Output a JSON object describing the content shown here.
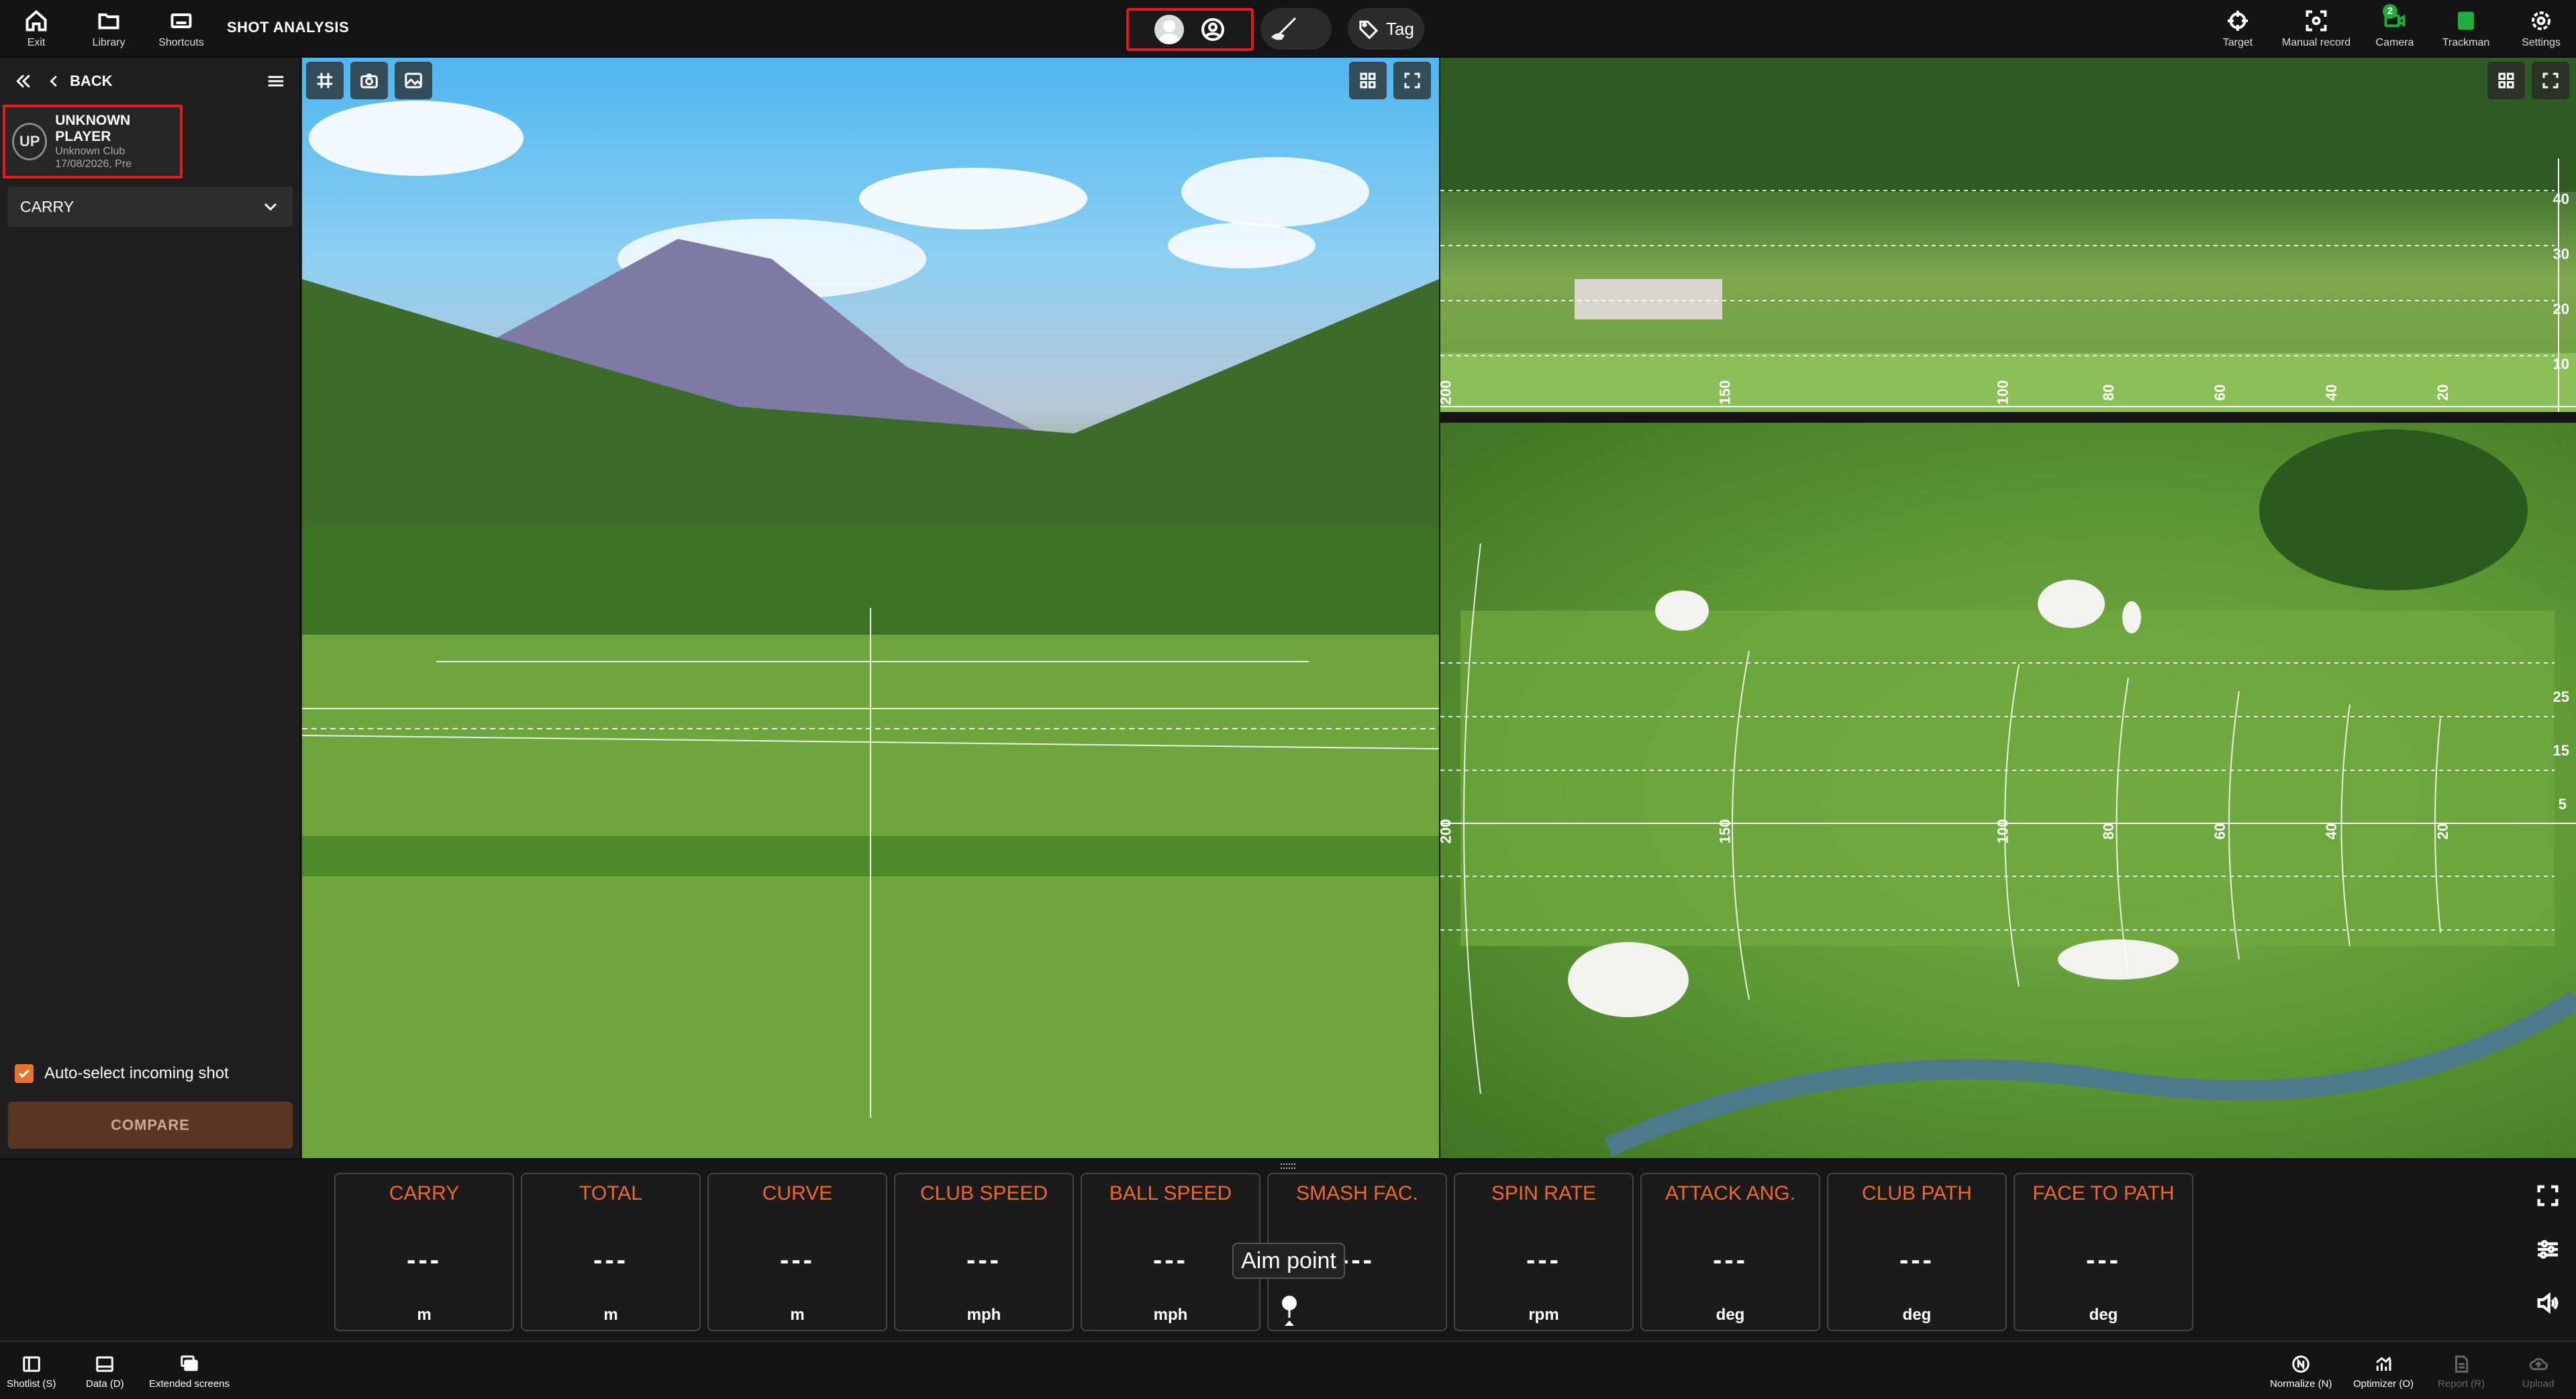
{
  "topbar": {
    "exit_label": "Exit",
    "library_label": "Library",
    "shortcuts_label": "Shortcuts",
    "title": "SHOT ANALYSIS",
    "tag_label": "Tag",
    "target_label": "Target",
    "manual_record_label": "Manual record",
    "camera_label": "Camera",
    "camera_badge": "2",
    "trackman_label": "Trackman",
    "settings_label": "Settings"
  },
  "sidebar": {
    "back_label": "BACK",
    "player": {
      "initials": "UP",
      "name": "UNKNOWN PLAYER",
      "club": "Unknown Club",
      "date": "17/08/2026, Pre"
    },
    "metric_select": "CARRY",
    "auto_select_label": "Auto-select incoming shot",
    "auto_select_checked": true,
    "compare_label": "COMPARE"
  },
  "side_view_distances": [
    "40",
    "30",
    "20",
    "10"
  ],
  "side_view_markers": [
    "200",
    "150",
    "100",
    "80",
    "60",
    "40",
    "20"
  ],
  "top_view_lateral": [
    "25",
    "15",
    "5"
  ],
  "top_view_markers": [
    "200",
    "150",
    "100",
    "80",
    "60",
    "40",
    "20"
  ],
  "metrics": [
    {
      "label": "CARRY",
      "value": "---",
      "unit": "m"
    },
    {
      "label": "TOTAL",
      "value": "---",
      "unit": "m"
    },
    {
      "label": "CURVE",
      "value": "---",
      "unit": "m"
    },
    {
      "label": "CLUB SPEED",
      "value": "---",
      "unit": "mph"
    },
    {
      "label": "BALL SPEED",
      "value": "---",
      "unit": "mph"
    },
    {
      "label": "SMASH FAC.",
      "value": "---",
      "unit": ""
    },
    {
      "label": "SPIN RATE",
      "value": "---",
      "unit": "rpm"
    },
    {
      "label": "ATTACK ANG.",
      "value": "---",
      "unit": "deg"
    },
    {
      "label": "CLUB PATH",
      "value": "---",
      "unit": "deg"
    },
    {
      "label": "FACE TO PATH",
      "value": "---",
      "unit": "deg"
    }
  ],
  "aim_point_label": "Aim point",
  "bottombar": {
    "shotlist_label": "Shotlist (S)",
    "data_label": "Data (D)",
    "extended_label": "Extended screens",
    "normalize_label": "Normalize (N)",
    "optimizer_label": "Optimizer (O)",
    "report_label": "Report (R)",
    "upload_label": "Upload"
  },
  "colors": {
    "accent": "#f0692c",
    "highlight": "#e31b1b",
    "compare_bg": "#5b3623"
  }
}
